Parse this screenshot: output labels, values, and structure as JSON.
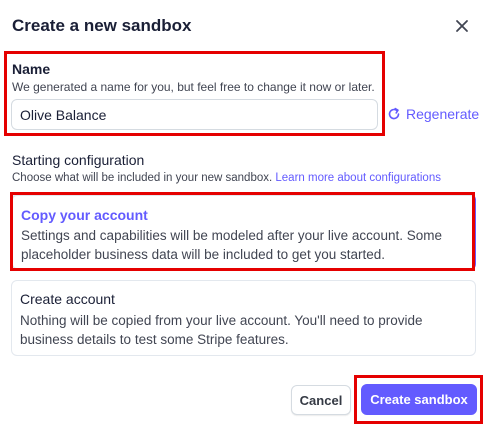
{
  "dialog": {
    "title": "Create a new sandbox",
    "close_icon": "close-icon"
  },
  "name_section": {
    "label": "Name",
    "description": "We generated a name for you, but feel free to change it now or later.",
    "value": "Olive Balance",
    "regenerate_label": "Regenerate",
    "regenerate_icon": "refresh-icon"
  },
  "config_section": {
    "title": "Starting configuration",
    "description": "Choose what will be included in your new sandbox.",
    "link_text": "Learn more about configurations",
    "options": [
      {
        "title": "Copy your account",
        "description": "Settings and capabilities will be modeled after your live account. Some placeholder business data will be included to get you started.",
        "selected": true
      },
      {
        "title": "Create account",
        "description": "Nothing will be copied from your live account. You'll need to provide business details to test some Stripe features.",
        "selected": false
      }
    ]
  },
  "footer": {
    "cancel_label": "Cancel",
    "create_label": "Create sandbox"
  },
  "colors": {
    "accent": "#635bff",
    "highlight": "#e50000",
    "text": "#1a1f36"
  }
}
